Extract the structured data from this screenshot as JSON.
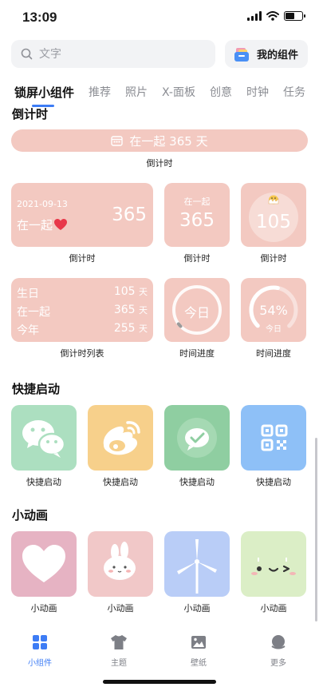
{
  "status_bar": {
    "time": "13:09"
  },
  "search": {
    "placeholder": "文字"
  },
  "my_widgets": {
    "label": "我的组件"
  },
  "tabs": [
    {
      "label": "锁屏小组件",
      "active": true
    },
    {
      "label": "推荐"
    },
    {
      "label": "照片"
    },
    {
      "label": "X-面板"
    },
    {
      "label": "创意"
    },
    {
      "label": "时钟"
    },
    {
      "label": "任务"
    }
  ],
  "countdown": {
    "title": "倒计时",
    "banner_text": "在一起 365 天",
    "banner_caption": "倒计时",
    "widget1": {
      "date": "2021-09-13",
      "text": "在一起",
      "number": "365",
      "caption": "倒计时"
    },
    "widget2": {
      "text": "在一起",
      "number": "365",
      "caption": "倒计时"
    },
    "widget3": {
      "number": "105",
      "caption": "倒计时"
    },
    "list": {
      "rows": [
        {
          "label": "生日",
          "value": "105",
          "unit": "天"
        },
        {
          "label": "在一起",
          "value": "365",
          "unit": "天"
        },
        {
          "label": "今年",
          "value": "255",
          "unit": "天"
        }
      ],
      "caption": "倒计时列表"
    },
    "progress1": {
      "label": "今日",
      "fraction": 0.03,
      "caption": "时间进度"
    },
    "progress2": {
      "percent": "54%",
      "label": "今日",
      "fraction": 0.54,
      "caption": "时间进度"
    }
  },
  "quick_launch": {
    "title": "快捷启动",
    "items": [
      {
        "icon": "wechat-icon",
        "caption": "快捷启动",
        "color": "#acdfc0"
      },
      {
        "icon": "weibo-icon",
        "caption": "快捷启动",
        "color": "#f7d08b"
      },
      {
        "icon": "check-bubble-icon",
        "caption": "快捷启动",
        "color": "#8fcea1"
      },
      {
        "icon": "qr-code-icon",
        "caption": "快捷启动",
        "color": "#8ec0f7"
      }
    ]
  },
  "animations": {
    "title": "小动画",
    "items": [
      {
        "icon": "heart-icon",
        "caption": "小动画",
        "color": "#e6b3c3"
      },
      {
        "icon": "bunny-icon",
        "caption": "小动画",
        "color": "#f1c8c8"
      },
      {
        "icon": "windmill-icon",
        "caption": "小动画",
        "color": "#b9cdf7"
      },
      {
        "icon": "wink-face-icon",
        "caption": "小动画",
        "color": "#dbeec6"
      }
    ]
  },
  "bottom_nav": [
    {
      "label": "小组件",
      "icon": "widgets-icon",
      "active": true
    },
    {
      "label": "主题",
      "icon": "tshirt-icon"
    },
    {
      "label": "壁纸",
      "icon": "image-icon"
    },
    {
      "label": "更多",
      "icon": "planet-icon"
    }
  ],
  "colors": {
    "accent": "#3d7cf5",
    "pink_card": "#f3c9c1"
  }
}
